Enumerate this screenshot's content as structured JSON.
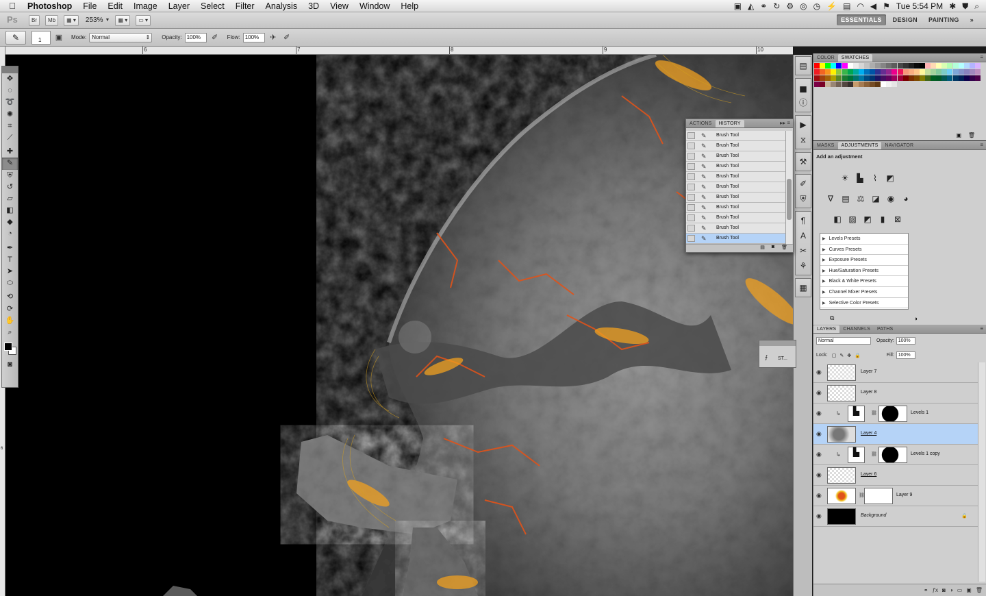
{
  "menubar": {
    "apple": "",
    "app": "Photoshop",
    "items": [
      "File",
      "Edit",
      "Image",
      "Layer",
      "Select",
      "Filter",
      "Analysis",
      "3D",
      "View",
      "Window",
      "Help"
    ],
    "clock": "Tue 5:54 PM"
  },
  "appbar": {
    "ps_label": "Ps",
    "bridge_label": "Br",
    "minibridge_label": "Mb",
    "zoom": "253%",
    "workspaces": [
      "ESSENTIALS",
      "DESIGN",
      "PAINTING"
    ],
    "more": "»"
  },
  "options": {
    "brush_size": "1",
    "mode_label": "Mode:",
    "mode_value": "Normal",
    "opacity_label": "Opacity:",
    "opacity_value": "100%",
    "flow_label": "Flow:",
    "flow_value": "100%"
  },
  "ruler": {
    "top_labels": [
      "6",
      "7",
      "8",
      "9",
      "10"
    ],
    "left_labels": [
      "6"
    ]
  },
  "history_panel": {
    "tabs": [
      "ACTIONS",
      "HISTORY"
    ],
    "active_tab": "HISTORY",
    "items": [
      "Brush Tool",
      "Brush Tool",
      "Brush Tool",
      "Brush Tool",
      "Brush Tool",
      "Brush Tool",
      "Brush Tool",
      "Brush Tool",
      "Brush Tool",
      "Brush Tool",
      "Brush Tool"
    ],
    "selected_item": "Brush Tool",
    "collapse": "▸▸"
  },
  "styles_panel": {
    "label": "ST..."
  },
  "color_panel": {
    "tabs": [
      "COLOR",
      "SWATCHES"
    ],
    "active_tab": "SWATCHES"
  },
  "adjustments_panel": {
    "tabs": [
      "MASKS",
      "ADJUSTMENTS",
      "NAVIGATOR"
    ],
    "active_tab": "ADJUSTMENTS",
    "heading": "Add an adjustment",
    "presets": [
      "Levels Presets",
      "Curves Presets",
      "Exposure Presets",
      "Hue/Saturation Presets",
      "Black & White Presets",
      "Channel Mixer Presets",
      "Selective Color Presets"
    ]
  },
  "layers_panel": {
    "tabs": [
      "LAYERS",
      "CHANNELS",
      "PATHS"
    ],
    "active_tab": "LAYERS",
    "blend_mode": "Normal",
    "opacity_label": "Opacity:",
    "opacity_value": "100%",
    "lock_label": "Lock:",
    "fill_label": "Fill:",
    "fill_value": "100%",
    "layers": [
      {
        "name": "Layer 7"
      },
      {
        "name": "Layer 8"
      },
      {
        "name": "Levels 1"
      },
      {
        "name": "Layer 4"
      },
      {
        "name": "Levels 1 copy"
      },
      {
        "name": "Layer 6"
      },
      {
        "name": "Layer 9"
      },
      {
        "name": "Background"
      }
    ],
    "selected_layer": "Layer 4"
  },
  "colors": {
    "selection_blue": "#b5d3f7",
    "panel_gray": "#cfcfcf",
    "canvas_black": "#000000",
    "lava_orange": "#e0531a",
    "lava_yellow": "#f0c020"
  },
  "icons": {
    "tools": [
      "move-icon",
      "marquee-icon",
      "lasso-icon",
      "quick-select-icon",
      "crop-icon",
      "eyedropper-icon",
      "healing-icon",
      "brush-icon",
      "clone-stamp-icon",
      "history-brush-icon",
      "eraser-icon",
      "gradient-icon",
      "blur-icon",
      "dodge-icon",
      "pen-icon",
      "type-icon",
      "path-select-icon",
      "shape-icon",
      "3d-rotate-icon",
      "3d-orbit-icon",
      "hand-icon",
      "zoom-icon"
    ]
  }
}
